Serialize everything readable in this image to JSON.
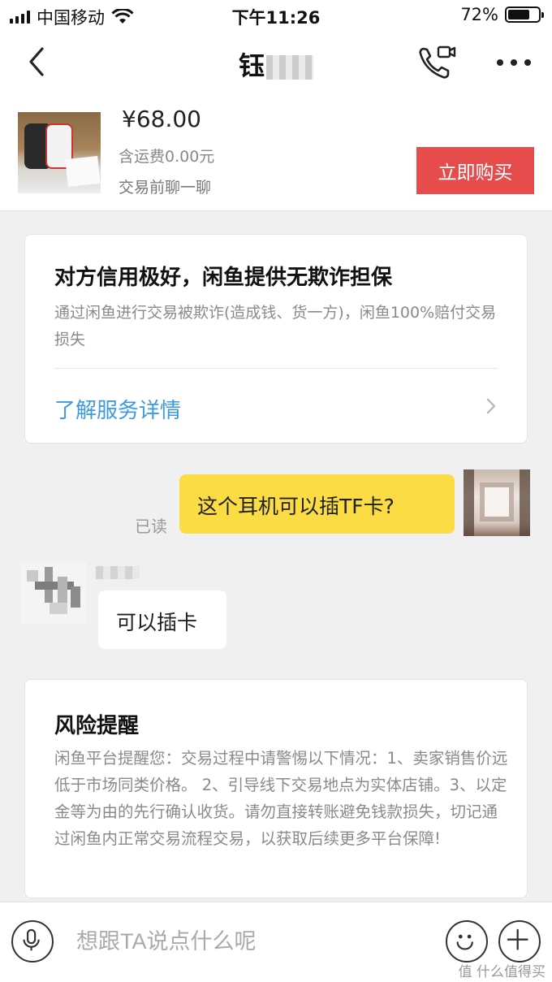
{
  "status_bar": {
    "carrier": "中国移动",
    "time": "下午11:26",
    "battery_percent": "72%",
    "battery_level": 0.72
  },
  "nav": {
    "title": "钰",
    "icons": [
      "back-arrow-icon",
      "video-call-icon",
      "more-icon"
    ]
  },
  "product": {
    "price": "¥68.00",
    "shipping": "含运费0.00元",
    "chat_hint": "交易前聊一聊",
    "buy_label": "立即购买",
    "buy_color": "#e74c4c"
  },
  "guarantee": {
    "title": "对方信用极好，闲鱼提供无欺诈担保",
    "desc": "通过闲鱼进行交易被欺诈(造成钱、货一方)，闲鱼100%赔付交易损失",
    "link": "了解服务详情",
    "link_color": "#3d9ae0"
  },
  "messages": [
    {
      "from": "me",
      "text": "这个耳机可以插TF卡?",
      "status": "已读",
      "bubble_color": "#fbdc45"
    },
    {
      "from": "other",
      "text": "可以插卡",
      "bubble_color": "#ffffff"
    }
  ],
  "risk": {
    "title": "风险提醒",
    "desc": "闲鱼平台提醒您：交易过程中请警惕以下情况：1、卖家销售价远低于市场同类价格。 2、引导线下交易地点为实体店铺。3、以定金等为由的先行确认收货。请勿直接转账避免钱款损失，切记通过闲鱼内正常交易流程交易，以获取后续更多平台保障!"
  },
  "input_bar": {
    "placeholder": "想跟TA说点什么呢",
    "icons": [
      "microphone-icon",
      "emoji-icon",
      "plus-icon"
    ]
  },
  "watermark": "值 什么值得买"
}
